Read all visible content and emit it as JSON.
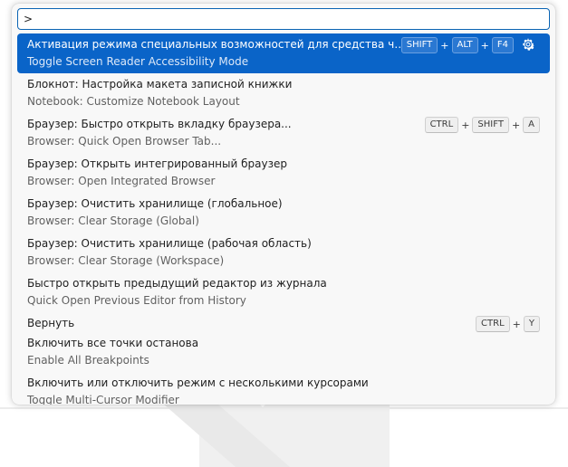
{
  "input": {
    "value": ">"
  },
  "items": [
    {
      "label": "Активация режима специальных возможностей для средства чтения с экрана",
      "detail": "Toggle Screen Reader Accessibility Mode",
      "keys": [
        "SHIFT",
        "ALT",
        "F4"
      ],
      "selected": true,
      "has_gear": true
    },
    {
      "label": "Блокнот: Настройка макета записной книжки",
      "detail": "Notebook: Customize Notebook Layout",
      "keys": []
    },
    {
      "label": "Браузер: Быстро открыть вкладку браузера...",
      "detail": "Browser: Quick Open Browser Tab...",
      "keys": [
        "CTRL",
        "SHIFT",
        "A"
      ]
    },
    {
      "label": "Браузер: Открыть интегрированный браузер",
      "detail": "Browser: Open Integrated Browser",
      "keys": []
    },
    {
      "label": "Браузер: Очистить хранилище (глобальное)",
      "detail": "Browser: Clear Storage (Global)",
      "keys": []
    },
    {
      "label": "Браузер: Очистить хранилище (рабочая область)",
      "detail": "Browser: Clear Storage (Workspace)",
      "keys": []
    },
    {
      "label": "Быстро открыть предыдущий редактор из журнала",
      "detail": "Quick Open Previous Editor from History",
      "keys": []
    },
    {
      "label": "Вернуть",
      "detail": "",
      "keys": [
        "CTRL",
        "Y"
      ]
    },
    {
      "label": "Включить все точки останова",
      "detail": "Enable All Breakpoints",
      "keys": []
    },
    {
      "label": "Включить или отключить режим с несколькими курсорами",
      "detail": "Toggle Multi-Cursor Modifier",
      "keys": []
    }
  ]
}
